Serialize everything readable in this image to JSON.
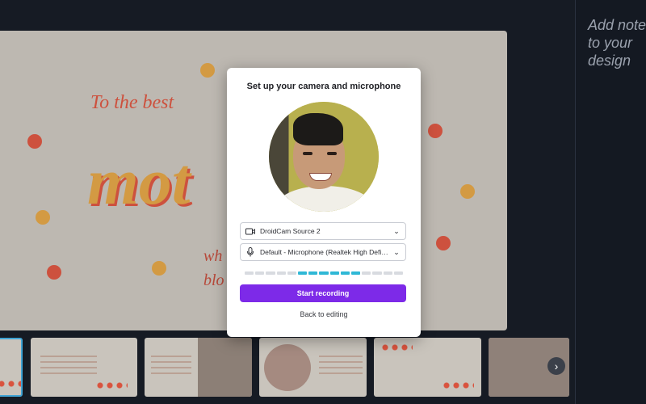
{
  "notes": {
    "placeholder": "Add notes to your\ndesign"
  },
  "canvas": {
    "heading_script": "To the best",
    "big_word": "mot",
    "partial_text_1": "wh",
    "partial_text_2": "blo"
  },
  "modal": {
    "title": "Set up your camera and microphone",
    "camera_select": {
      "icon": "video-camera-icon",
      "value": "DroidCam Source 2"
    },
    "mic_select": {
      "icon": "microphone-icon",
      "value": "Default - Microphone (Realtek High Definition Audio)"
    },
    "mic_level": {
      "segments": 15,
      "active_from": 5,
      "active_to": 10
    },
    "start_button": "Start recording",
    "back_link": "Back to editing",
    "accent_color": "#7d2ae8"
  },
  "filmstrip": {
    "next_icon": "chevron-right-icon"
  }
}
